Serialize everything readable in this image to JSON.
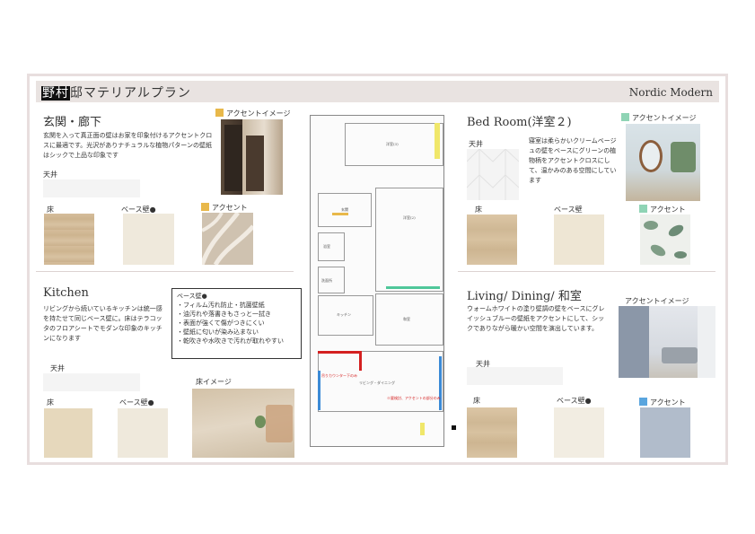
{
  "header": {
    "title_masked": "野村",
    "title_rest": "邸マテリアルプラン",
    "style_name": "Nordic Modern"
  },
  "entrance": {
    "title": "玄関・廊下",
    "accent_image_label": "アクセントイメージ",
    "description": "玄関を入って真正面の壁はお家を印象付けるアクセントクロスに最適です。光沢がありナチュラルな植物パターンの壁紙はシックで上品な印象です",
    "ceiling_label": "天井",
    "floor_label": "床",
    "base_wall_label": "ベース壁●",
    "accent_label": "アクセント",
    "accent_color": "#e8b84a"
  },
  "bedroom": {
    "title": "Bed Room(洋室２)",
    "accent_image_label": "アクセントイメージ",
    "ceiling_label": "天井",
    "description": "寝室は柔らかいクリームベージュの壁をベースにグリーンの植物柄をアクセントクロスにして、温かみのある空間にしています",
    "floor_label": "床",
    "base_wall_label": "ベース壁",
    "accent_label": "アクセント",
    "accent_color": "#8fd4b5"
  },
  "kitchen": {
    "title": "Kitchen",
    "description": "リビングから続いているキッチンは統一感を持たせて同じベース壁に。床はテラコッタのフロアシートでモダンな印象のキッチンになります",
    "ceiling_label": "天井",
    "floor_label": "床",
    "base_wall_label": "ベース壁●",
    "floor_image_label": "床イメージ",
    "callout_title": "ベース壁●",
    "callout_items": [
      "・フィルム汚れ防止・抗菌壁紙",
      "・油汚れや落書きもさっと一拭き",
      "・表面が強くて傷がつきにくい",
      "・壁紙に匂いが染み込まない",
      "・乾吹きや水吹きで汚れが取れやすい"
    ]
  },
  "living": {
    "title": "Living/ Dining/ 和室",
    "accent_image_label": "アクセントイメージ",
    "description": "ウォームホワイトの塗り壁調の壁をベースにグレイッシュブルーの壁紙をアクセントにして、シックでありながら暖かい空間を演出しています。",
    "ceiling_label": "天井",
    "floor_label": "床",
    "base_wall_label": "ベース壁●",
    "accent_label": "アクセント",
    "accent_color": "#5aa5de",
    "accent_swatch_color": "#b1bccb"
  },
  "plan": {
    "rooms": [
      "洋室(3)",
      "洋室(2)",
      "洋室",
      "キッチン",
      "和室",
      "リビング・ダイニング",
      "浴室",
      "洗面所",
      "玄関"
    ],
    "note_red": "吊りカウンター下のみ",
    "note_red2": "※要検討、アクセントの部分のみ"
  }
}
